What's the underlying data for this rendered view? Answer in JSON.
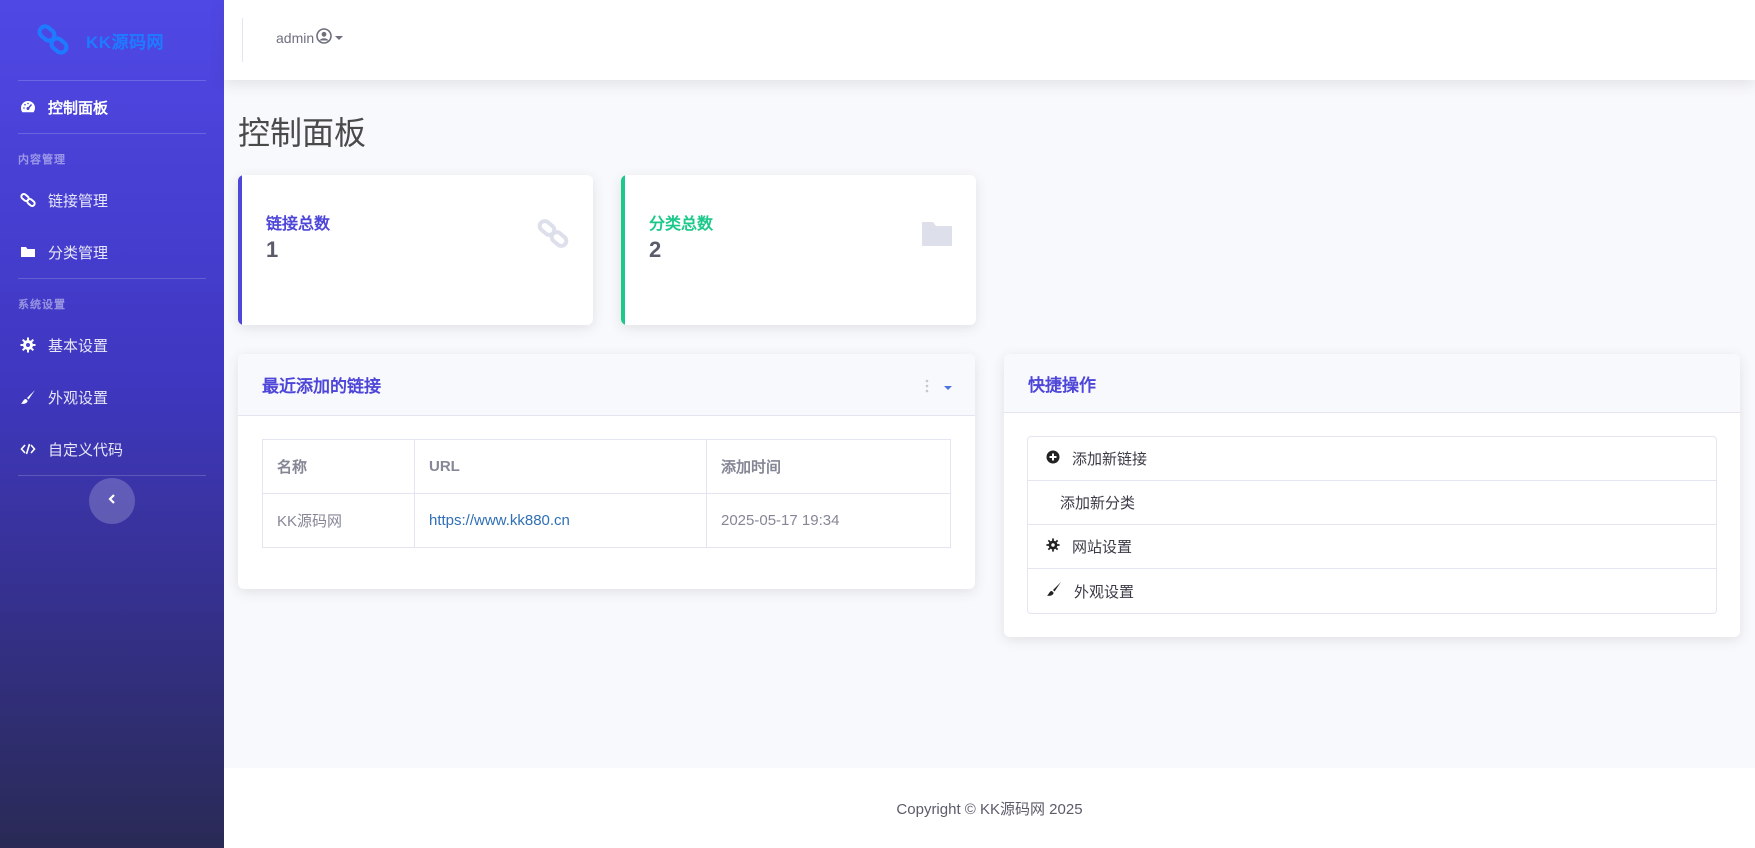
{
  "brand": {
    "name": "KK源码网",
    "color": "#1e7bff"
  },
  "sidebar": {
    "dashboard": {
      "label": "控制面板",
      "icon": "tachometer-icon"
    },
    "heading_content": "内容管理",
    "links": {
      "label": "链接管理",
      "icon": "link-icon"
    },
    "categories": {
      "label": "分类管理",
      "icon": "folder-icon"
    },
    "heading_system": "系统设置",
    "basic_settings": {
      "label": "基本设置",
      "icon": "gear-icon"
    },
    "appearance": {
      "label": "外观设置",
      "icon": "paintbrush-icon"
    },
    "custom_code": {
      "label": "自定义代码",
      "icon": "code-icon"
    }
  },
  "topbar": {
    "user": "admin"
  },
  "page": {
    "title": "控制面板"
  },
  "stats": {
    "links": {
      "label": "链接总数",
      "value": "1",
      "color": "#4e46d8"
    },
    "categories": {
      "label": "分类总数",
      "value": "2",
      "color": "#1cc88a"
    }
  },
  "recent_links": {
    "title": "最近添加的链接",
    "columns": [
      "名称",
      "URL",
      "添加时间"
    ],
    "rows": [
      {
        "name": "KK源码网",
        "url": "https://www.kk880.cn",
        "time": "2025-05-17 19:34"
      }
    ]
  },
  "quick_actions": {
    "title": "快捷操作",
    "items": [
      {
        "label": "添加新链接",
        "icon": "plus-circle-icon"
      },
      {
        "label": "添加新分类",
        "icon": ""
      },
      {
        "label": "网站设置",
        "icon": "gear-icon"
      },
      {
        "label": "外观设置",
        "icon": "paintbrush-icon"
      }
    ]
  },
  "footer": {
    "text": "Copyright © KK源码网 2025"
  }
}
